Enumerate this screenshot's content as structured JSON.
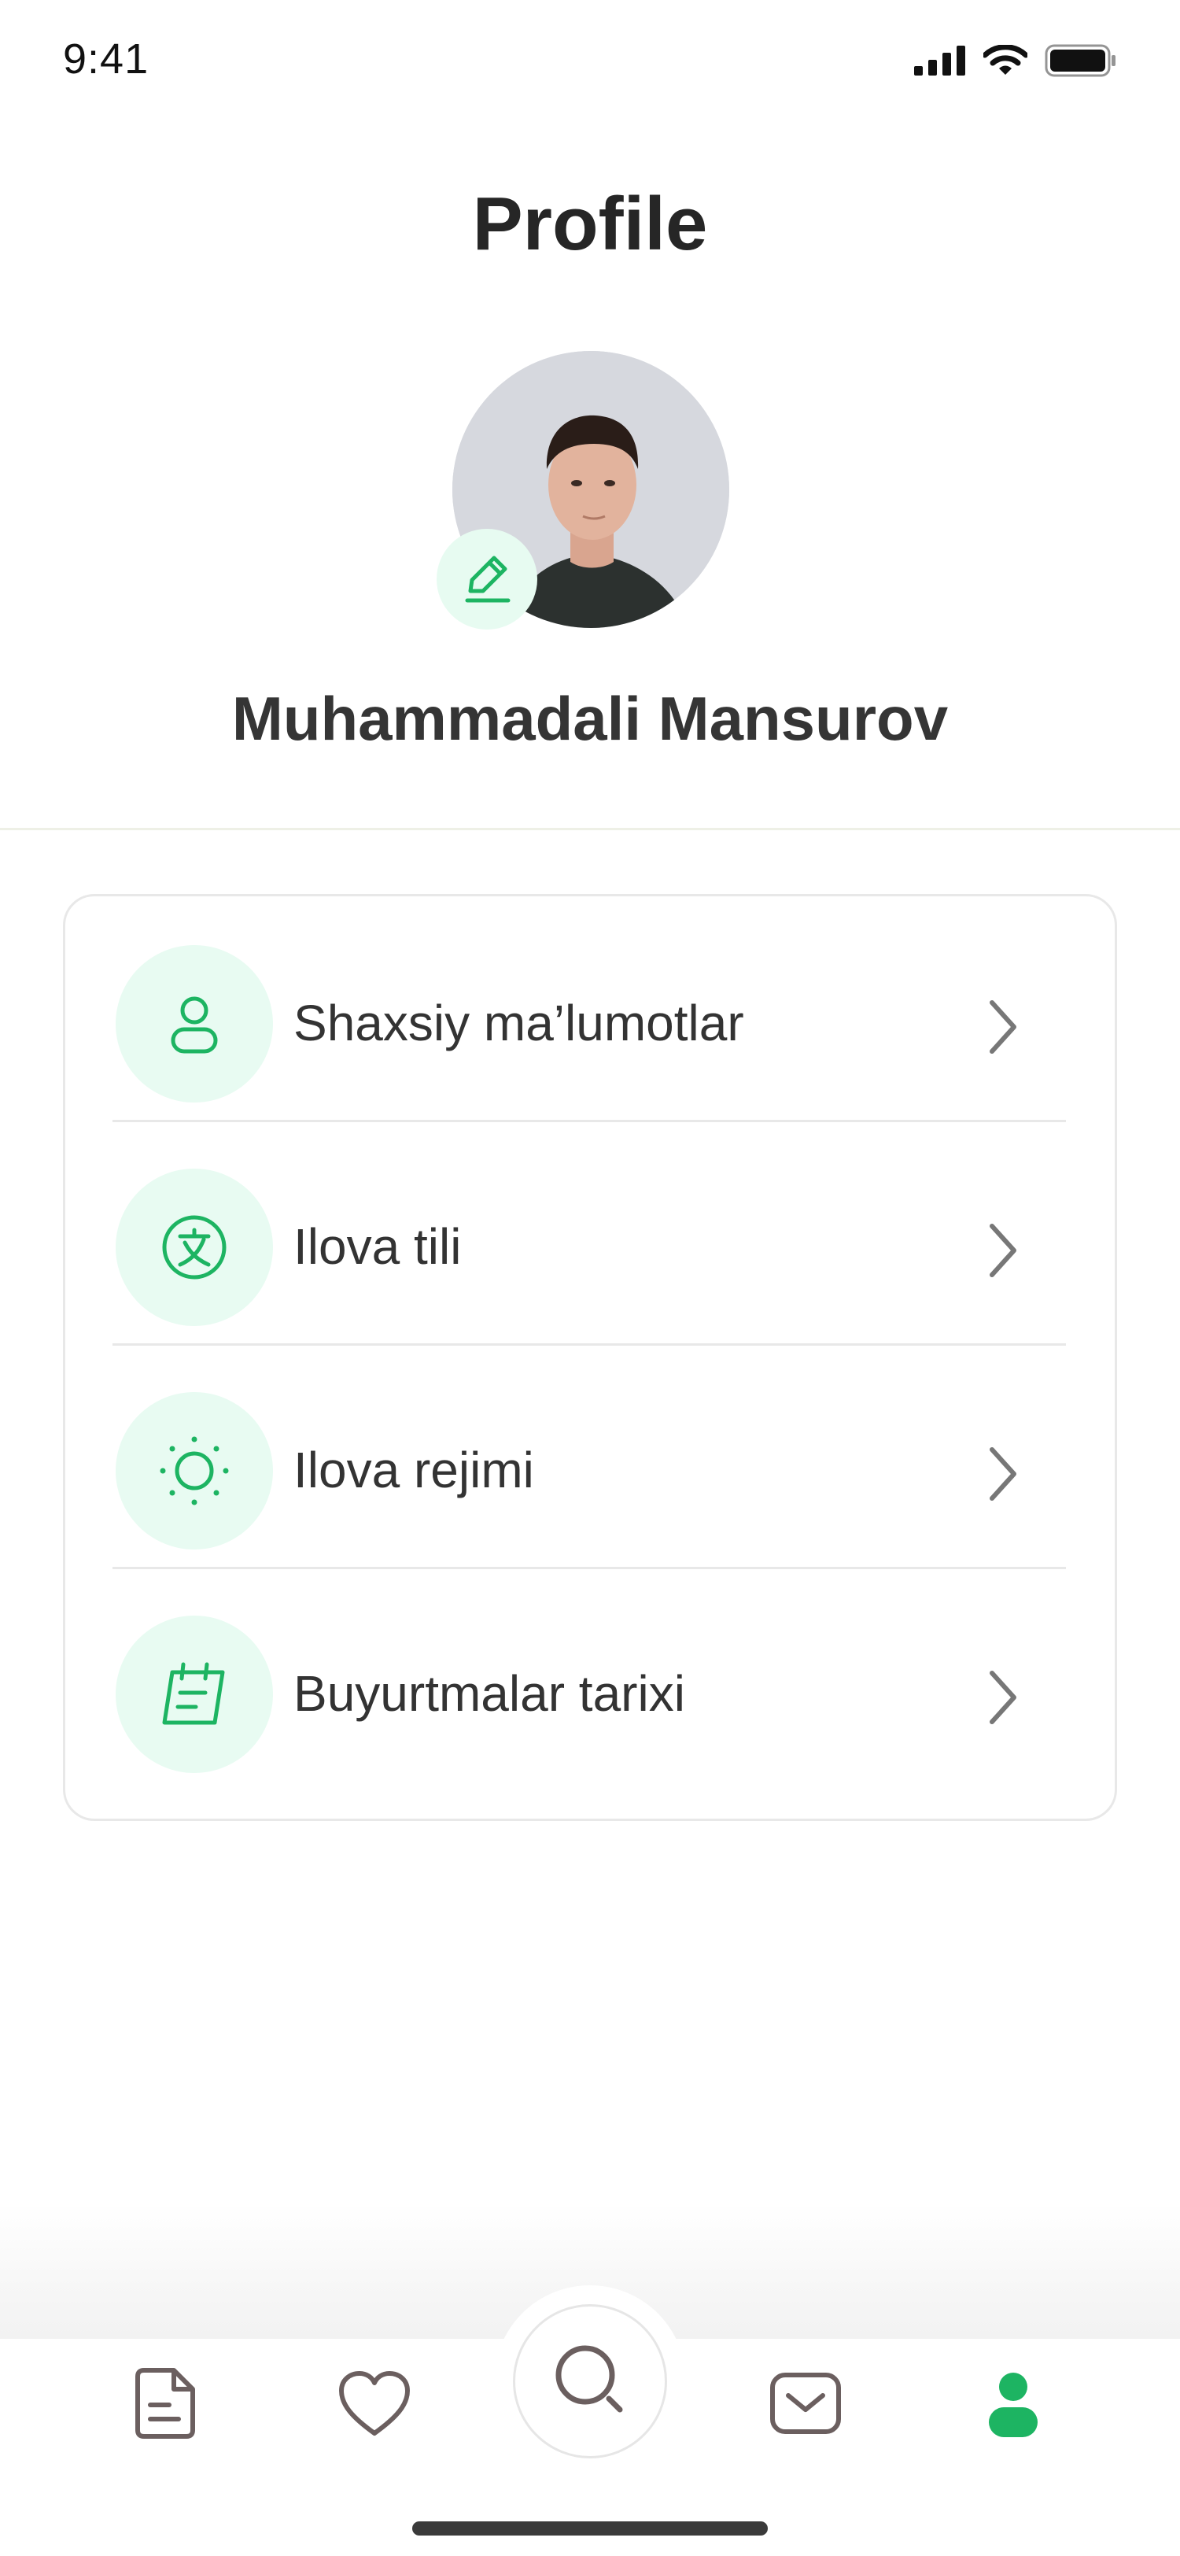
{
  "status_bar": {
    "time": "9:41",
    "icons": [
      "signal-icon",
      "wifi-icon",
      "battery-icon"
    ]
  },
  "header": {
    "title": "Profile"
  },
  "profile": {
    "name": "Muhammadali Mansurov",
    "edit_icon": "pencil-icon"
  },
  "menu": {
    "items": [
      {
        "label": "Shaxsiy ma’lumotlar",
        "icon": "user-icon"
      },
      {
        "label": "Ilova tili",
        "icon": "translate-icon"
      },
      {
        "label": "Ilova rejimi",
        "icon": "sun-icon"
      },
      {
        "label": "Buyurtmalar tarixi",
        "icon": "calendar-notes-icon"
      }
    ]
  },
  "tab_bar": {
    "tabs": [
      {
        "name": "documents",
        "icon": "document-icon",
        "active": false
      },
      {
        "name": "favorites",
        "icon": "heart-icon",
        "active": false
      },
      {
        "name": "search",
        "icon": "search-icon",
        "active": false
      },
      {
        "name": "messages",
        "icon": "mail-icon",
        "active": false
      },
      {
        "name": "profile",
        "icon": "user-filled-icon",
        "active": true
      }
    ]
  },
  "colors": {
    "accent": "#1db462",
    "accent_soft": "#e8fbf2",
    "icon_inactive": "#6b5f5f",
    "text": "#333333"
  }
}
